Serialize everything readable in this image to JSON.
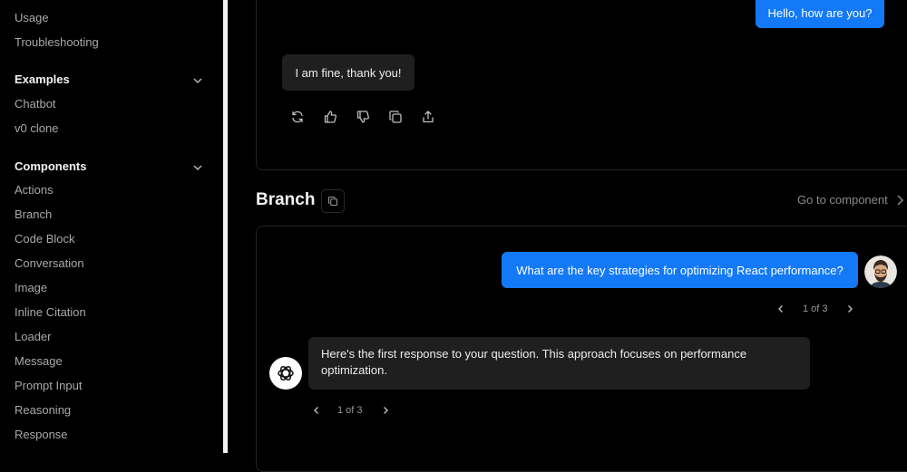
{
  "sidebar": {
    "getting_started_items": [
      "Usage",
      "Troubleshooting"
    ],
    "examples": {
      "heading": "Examples",
      "items": [
        "Chatbot",
        "v0 clone"
      ]
    },
    "components": {
      "heading": "Components",
      "items": [
        "Actions",
        "Branch",
        "Code Block",
        "Conversation",
        "Image",
        "Inline Citation",
        "Loader",
        "Message",
        "Prompt Input",
        "Reasoning",
        "Response"
      ]
    }
  },
  "actions_demo": {
    "user_message": "Hello, how are you?",
    "assistant_message": "I am fine, thank you!",
    "action_icons": [
      "retry-icon",
      "thumbs-up-icon",
      "thumbs-down-icon",
      "copy-icon",
      "share-icon"
    ]
  },
  "branch_section": {
    "title": "Branch",
    "goto_label": "Go to component",
    "user_message": "What are the key strategies for optimizing React performance?",
    "user_pager": "1 of 3",
    "assistant_message": "Here's the first response to your question. This approach focuses on performance optimization.",
    "assistant_pager": "1 of 3"
  },
  "colors": {
    "user_bubble": "#1479f6",
    "assistant_bubble": "#1f1f1f",
    "background": "#000000"
  }
}
